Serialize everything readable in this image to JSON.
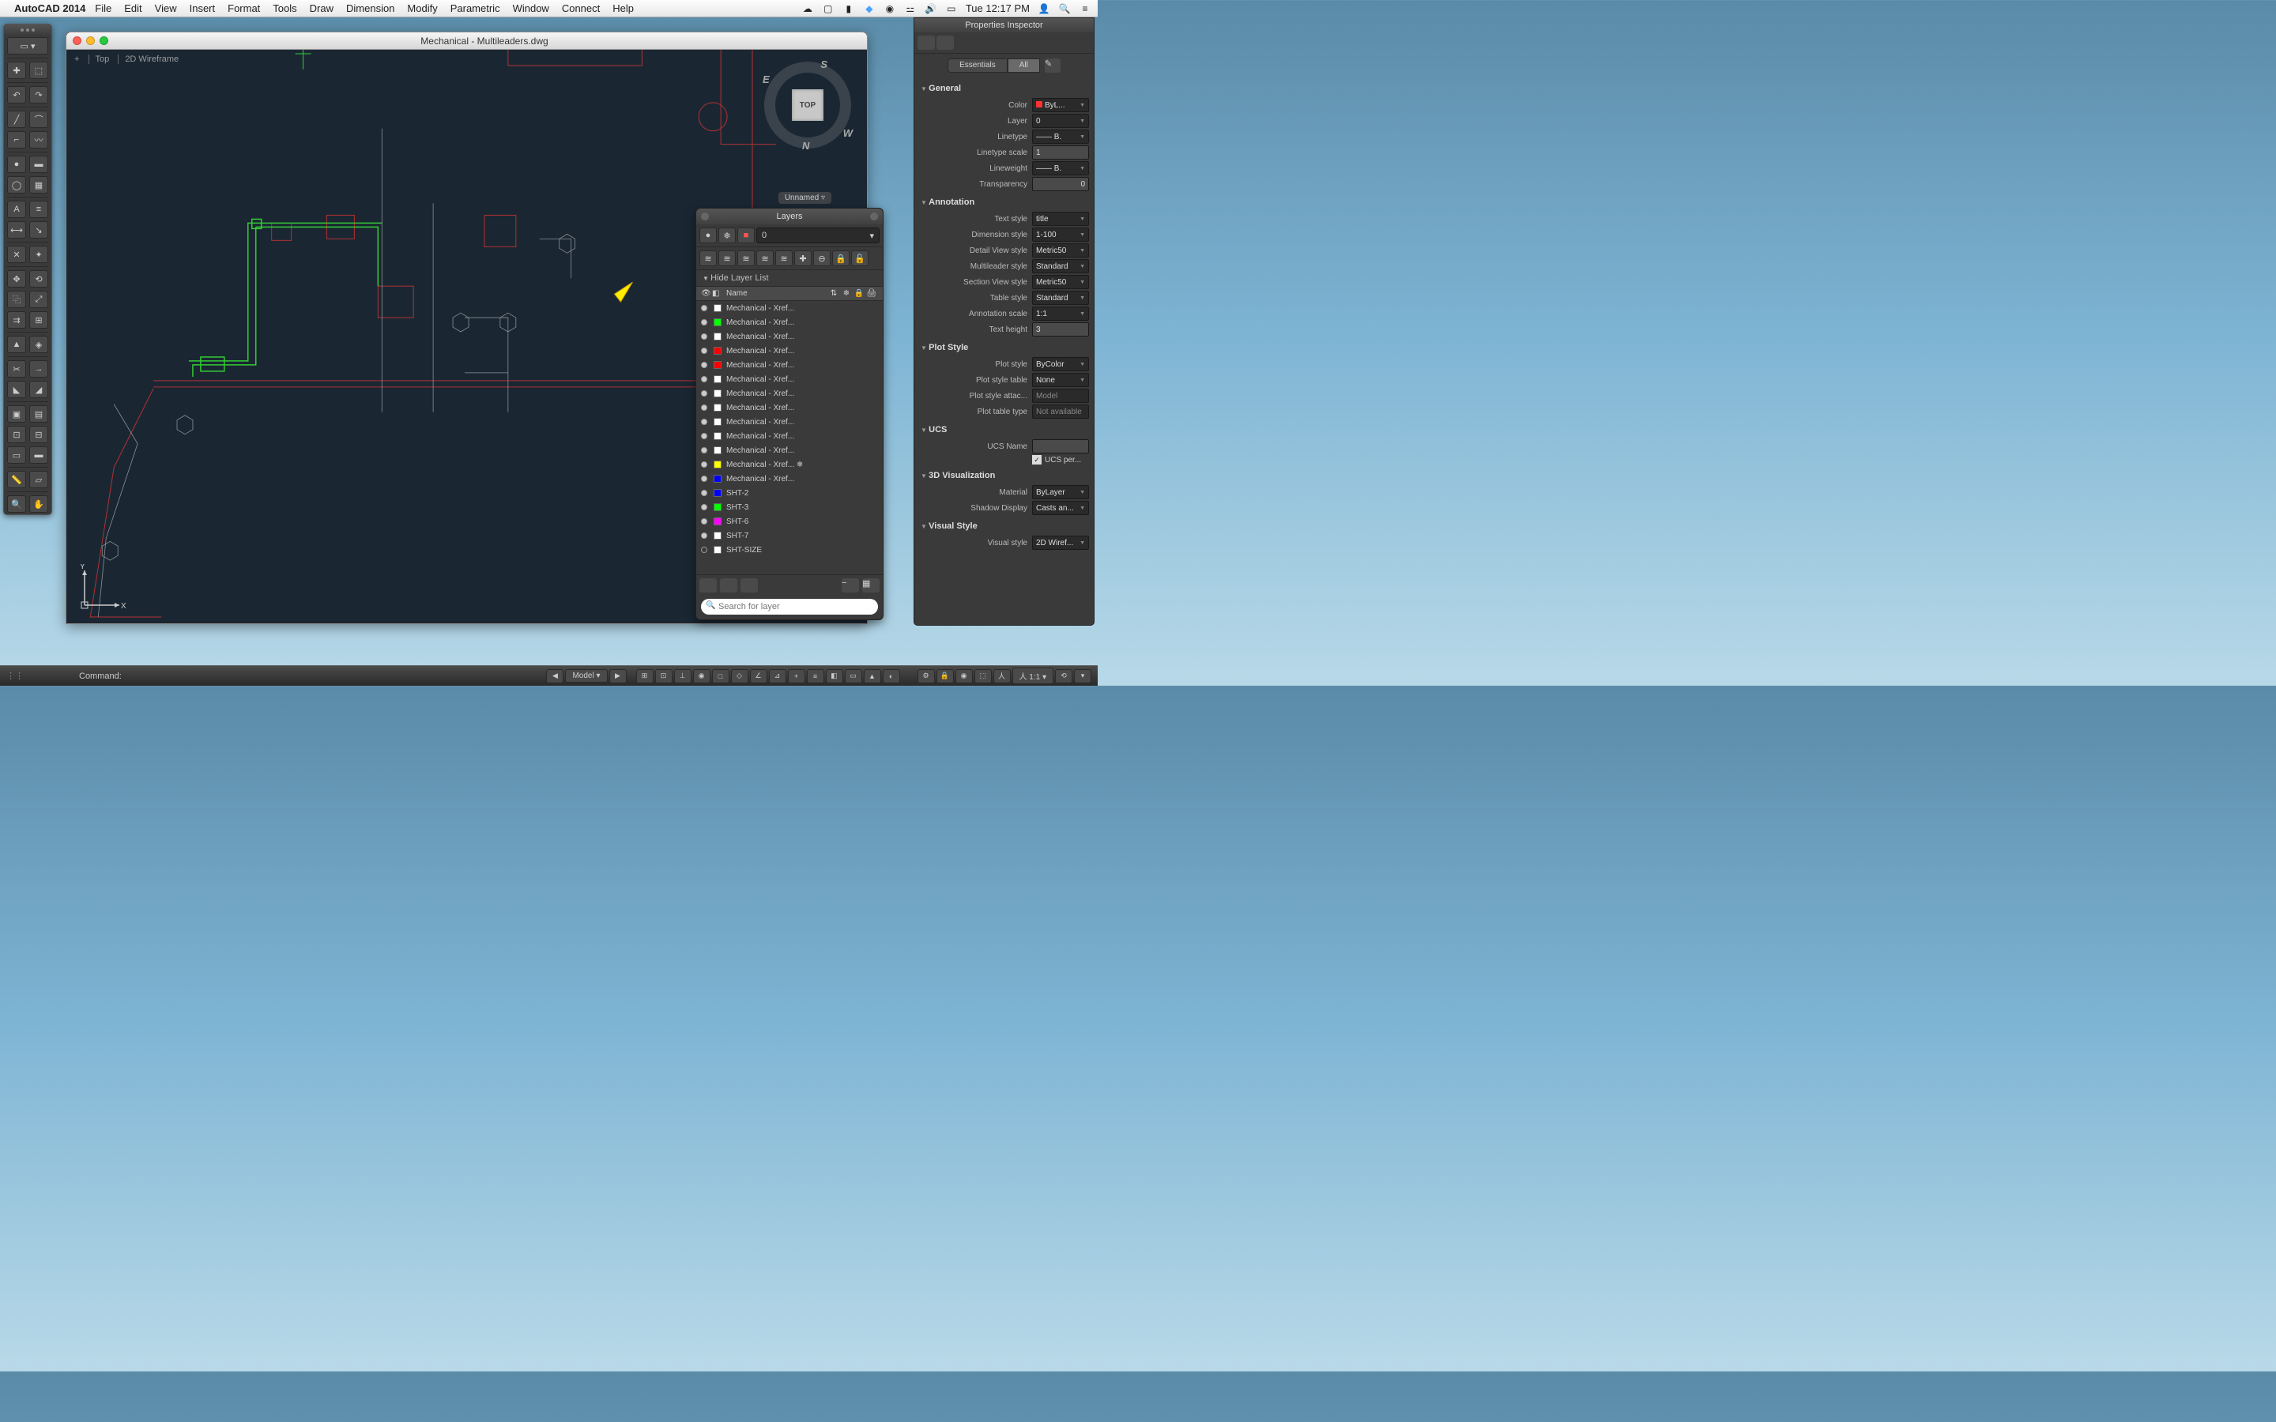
{
  "menubar": {
    "app_name": "AutoCAD 2014",
    "items": [
      "File",
      "Edit",
      "View",
      "Insert",
      "Format",
      "Tools",
      "Draw",
      "Dimension",
      "Modify",
      "Parametric",
      "Window",
      "Connect",
      "Help"
    ],
    "clock": "Tue 12:17 PM"
  },
  "document": {
    "title": "Mechanical - Multileaders.dwg",
    "view_labels": [
      "Top",
      "2D Wireframe"
    ],
    "viewcube": {
      "face": "TOP",
      "n": "N",
      "s": "S",
      "e": "E",
      "w": "W"
    },
    "ucs_dropdown": "Unnamed"
  },
  "layers_panel": {
    "title": "Layers",
    "current_layer": "0",
    "hide_label": "Hide Layer List",
    "name_col": "Name",
    "search_placeholder": "Search for layer",
    "layers": [
      {
        "name": "Mechanical - Xref...",
        "color": "#ffffff",
        "on": true
      },
      {
        "name": "Mechanical - Xref...",
        "color": "#00ff00",
        "on": true
      },
      {
        "name": "Mechanical - Xref...",
        "color": "#ffffff",
        "on": true
      },
      {
        "name": "Mechanical - Xref...",
        "color": "#ff0000",
        "on": true
      },
      {
        "name": "Mechanical - Xref...",
        "color": "#ff0000",
        "on": true
      },
      {
        "name": "Mechanical - Xref...",
        "color": "#ffffff",
        "on": true
      },
      {
        "name": "Mechanical - Xref...",
        "color": "#ffffff",
        "on": true
      },
      {
        "name": "Mechanical - Xref...",
        "color": "#ffffff",
        "on": true
      },
      {
        "name": "Mechanical - Xref...",
        "color": "#ffffff",
        "on": true
      },
      {
        "name": "Mechanical - Xref...",
        "color": "#ffffff",
        "on": true
      },
      {
        "name": "Mechanical - Xref...",
        "color": "#ffffff",
        "on": true
      },
      {
        "name": "Mechanical - Xref... ❄",
        "color": "#ffff00",
        "on": true
      },
      {
        "name": "Mechanical - Xref...",
        "color": "#0000ff",
        "on": true
      },
      {
        "name": "SHT-2",
        "color": "#0000ff",
        "on": true
      },
      {
        "name": "SHT-3",
        "color": "#00ff00",
        "on": true
      },
      {
        "name": "SHT-6",
        "color": "#ff00ff",
        "on": true
      },
      {
        "name": "SHT-7",
        "color": "#ffffff",
        "on": true
      },
      {
        "name": "SHT-SIZE",
        "color": "#ffffff",
        "on": false
      }
    ]
  },
  "properties": {
    "title": "Properties Inspector",
    "tabs": {
      "essentials": "Essentials",
      "all": "All"
    },
    "sections": {
      "general": {
        "title": "General",
        "color": {
          "label": "Color",
          "value": "ByL...",
          "swatch": "#ff0000"
        },
        "layer": {
          "label": "Layer",
          "value": "0"
        },
        "linetype": {
          "label": "Linetype",
          "value": "B."
        },
        "linetype_scale": {
          "label": "Linetype scale",
          "value": "1"
        },
        "lineweight": {
          "label": "Lineweight",
          "value": "B."
        },
        "transparency": {
          "label": "Transparency",
          "value": "0"
        }
      },
      "annotation": {
        "title": "Annotation",
        "text_style": {
          "label": "Text style",
          "value": "title"
        },
        "dimension_style": {
          "label": "Dimension style",
          "value": "1-100"
        },
        "detail_view_style": {
          "label": "Detail View style",
          "value": "Metric50"
        },
        "multileader_style": {
          "label": "Multileader style",
          "value": "Standard"
        },
        "section_view_style": {
          "label": "Section View style",
          "value": "Metric50"
        },
        "table_style": {
          "label": "Table style",
          "value": "Standard"
        },
        "annotation_scale": {
          "label": "Annotation scale",
          "value": "1:1"
        },
        "text_height": {
          "label": "Text height",
          "value": "3"
        }
      },
      "plot_style": {
        "title": "Plot Style",
        "plot_style": {
          "label": "Plot style",
          "value": "ByColor"
        },
        "plot_style_table": {
          "label": "Plot style table",
          "value": "None"
        },
        "plot_style_attached": {
          "label": "Plot style attac...",
          "value": "Model"
        },
        "plot_table_type": {
          "label": "Plot table type",
          "value": "Not available"
        }
      },
      "ucs": {
        "title": "UCS",
        "ucs_name": {
          "label": "UCS Name",
          "value": ""
        },
        "ucs_per": {
          "label": "UCS per...",
          "checked": true
        }
      },
      "viz3d": {
        "title": "3D Visualization",
        "material": {
          "label": "Material",
          "value": "ByLayer"
        },
        "shadow_display": {
          "label": "Shadow Display",
          "value": "Casts an..."
        }
      },
      "visual_style": {
        "title": "Visual Style",
        "visual_style": {
          "label": "Visual style",
          "value": "2D Wiref..."
        }
      }
    }
  },
  "command_bar": {
    "label": "Command:",
    "model_tab": "Model",
    "scale": "1:1"
  },
  "ucs_axes": {
    "x": "X",
    "y": "Y"
  }
}
